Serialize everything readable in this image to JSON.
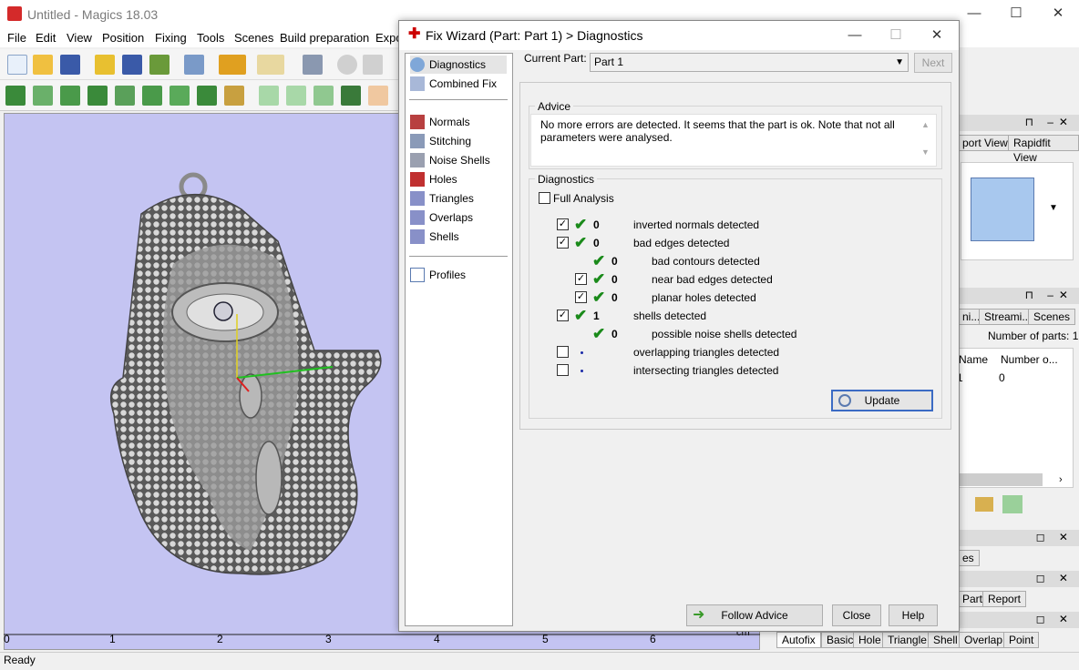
{
  "app": {
    "title": "Untitled - Magics 18.03"
  },
  "window_controls": {
    "minimize": "—",
    "maximize": "☐",
    "close": "✕"
  },
  "menu": [
    "File",
    "Edit",
    "View",
    "Position",
    "Fixing",
    "Tools",
    "Scenes",
    "Build preparation",
    "Expo"
  ],
  "ruler": {
    "labels": [
      "0",
      "1",
      "2",
      "3",
      "4",
      "5",
      "6"
    ],
    "unit": "cm"
  },
  "status": "Ready",
  "right_dock": {
    "tabs_top": [
      "port View",
      "Rapidfit View"
    ],
    "tabs_mid": [
      "ni...",
      "Streami...",
      "Scenes"
    ],
    "parts_label": "Number of parts: 1",
    "col1": "Name",
    "col2": "Number o...",
    "row_val": "0",
    "row_name": "1",
    "tab_es": "es",
    "tabs_part": [
      "Part",
      "Report"
    ]
  },
  "bottom_tabs": [
    "Autofix",
    "Basic",
    "Hole",
    "Triangle",
    "Shell",
    "Overlap",
    "Point"
  ],
  "dialog": {
    "title": "Fix Wizard (Part: Part 1) > Diagnostics",
    "current_part_label": "Current Part:",
    "current_part_value": "Part 1",
    "next": "Next",
    "nav": [
      "Diagnostics",
      "Combined Fix",
      "Normals",
      "Stitching",
      "Noise Shells",
      "Holes",
      "Triangles",
      "Overlaps",
      "Shells",
      "Profiles"
    ],
    "advice_title": "Advice",
    "advice_text": "No more errors are detected. It seems that the part is ok. Note that not all parameters were analysed.",
    "diagnostics_title": "Diagnostics",
    "full_analysis": "Full Analysis",
    "rows": [
      {
        "count": "0",
        "label": "inverted normals detected"
      },
      {
        "count": "0",
        "label": "bad edges detected"
      },
      {
        "count": "0",
        "label": "bad contours detected"
      },
      {
        "count": "0",
        "label": "near bad edges detected"
      },
      {
        "count": "0",
        "label": "planar holes detected"
      },
      {
        "count": "1",
        "label": "shells detected"
      },
      {
        "count": "0",
        "label": "possible noise shells detected"
      },
      {
        "count": "",
        "label": "overlapping triangles detected"
      },
      {
        "count": "",
        "label": "intersecting triangles detected"
      }
    ],
    "update": "Update",
    "follow_advice": "Follow Advice",
    "close": "Close",
    "help": "Help"
  }
}
